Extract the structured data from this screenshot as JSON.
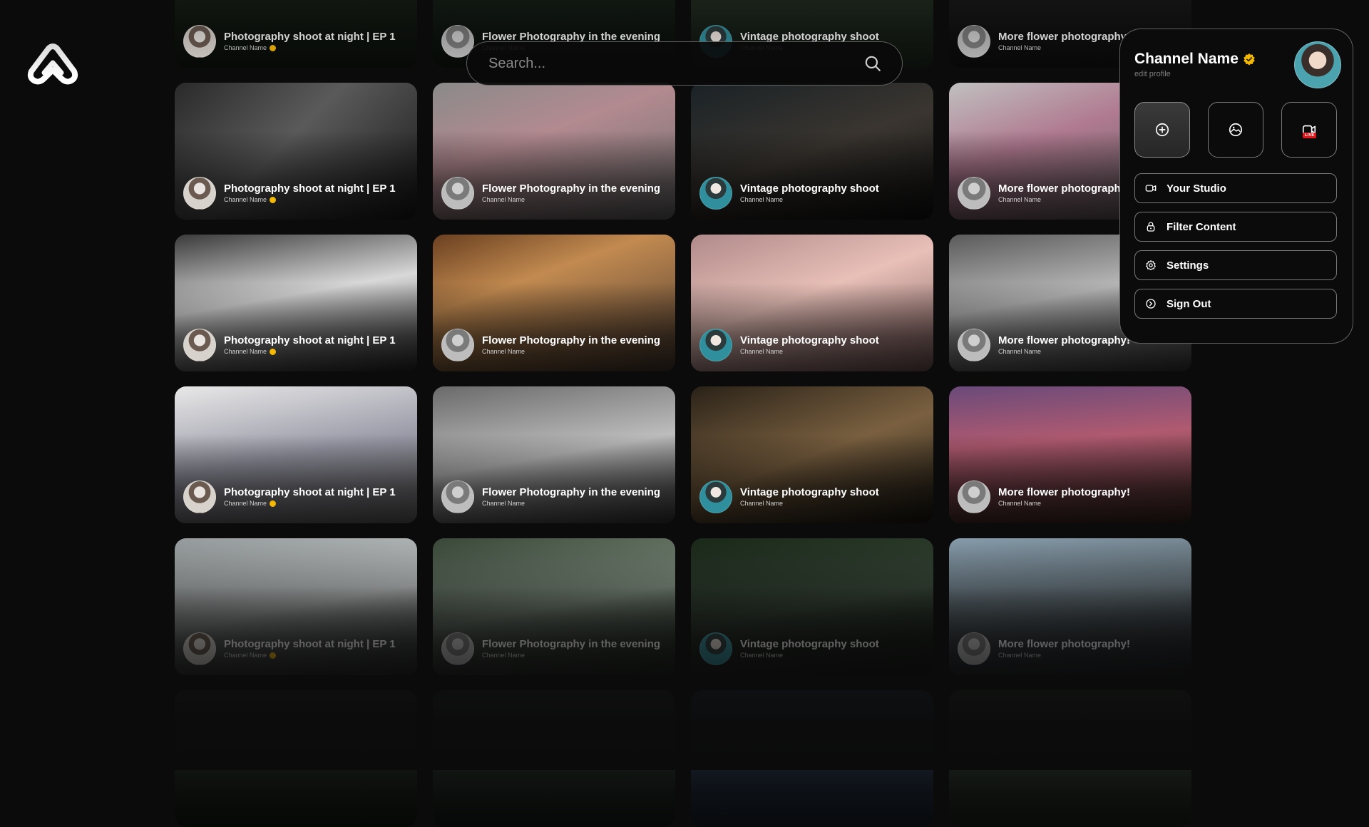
{
  "search": {
    "placeholder": "Search..."
  },
  "profile": {
    "channel_name": "Channel Name",
    "edit_link": "edit profile",
    "quick_actions": [
      {
        "icon": "add-circle-icon"
      },
      {
        "icon": "image-icon"
      },
      {
        "icon": "live-camera-icon",
        "badge": "LIVE"
      }
    ],
    "menu": [
      {
        "label": "Your Studio",
        "icon": "video-camera-icon"
      },
      {
        "label": "Filter Content",
        "icon": "lock-icon"
      },
      {
        "label": "Settings",
        "icon": "gear-icon"
      },
      {
        "label": "Sign Out",
        "icon": "sign-out-icon"
      }
    ]
  },
  "columns": [
    {
      "title": "Photography shoot at night | EP 1",
      "channel": "Channel Name",
      "verified": true
    },
    {
      "title": "Flower Photography in the evening",
      "channel": "Channel Name",
      "verified": false
    },
    {
      "title": "Vintage photography shoot",
      "channel": "Channel Name",
      "verified": false
    },
    {
      "title": "More flower photography!",
      "channel": "Channel Name",
      "verified": false
    }
  ],
  "colors": {
    "background": "#0b0b0b",
    "verified_badge": "#f5b800",
    "live_badge": "#e0161b"
  }
}
